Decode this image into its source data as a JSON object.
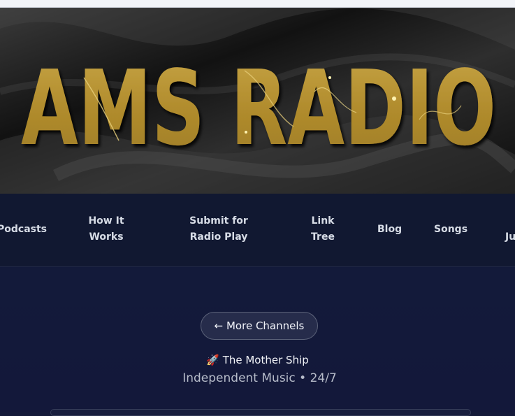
{
  "banner": {
    "logo_text": "AMS RADIO"
  },
  "nav": {
    "items": [
      {
        "label": "Podcasts"
      },
      {
        "label": "How It Works"
      },
      {
        "label": "Submit for Radio Play"
      },
      {
        "label": "Link Tree"
      },
      {
        "label": "Blog"
      },
      {
        "label": "Songs"
      },
      {
        "label": "Ju"
      }
    ]
  },
  "main": {
    "more_channels_label": "← More Channels",
    "station_label": "🚀 The Mother Ship",
    "subtitle": "Independent Music • 24/7"
  },
  "colors": {
    "gold": "#b89535",
    "navy": "#131a3a",
    "nav_bg": "#111831"
  }
}
